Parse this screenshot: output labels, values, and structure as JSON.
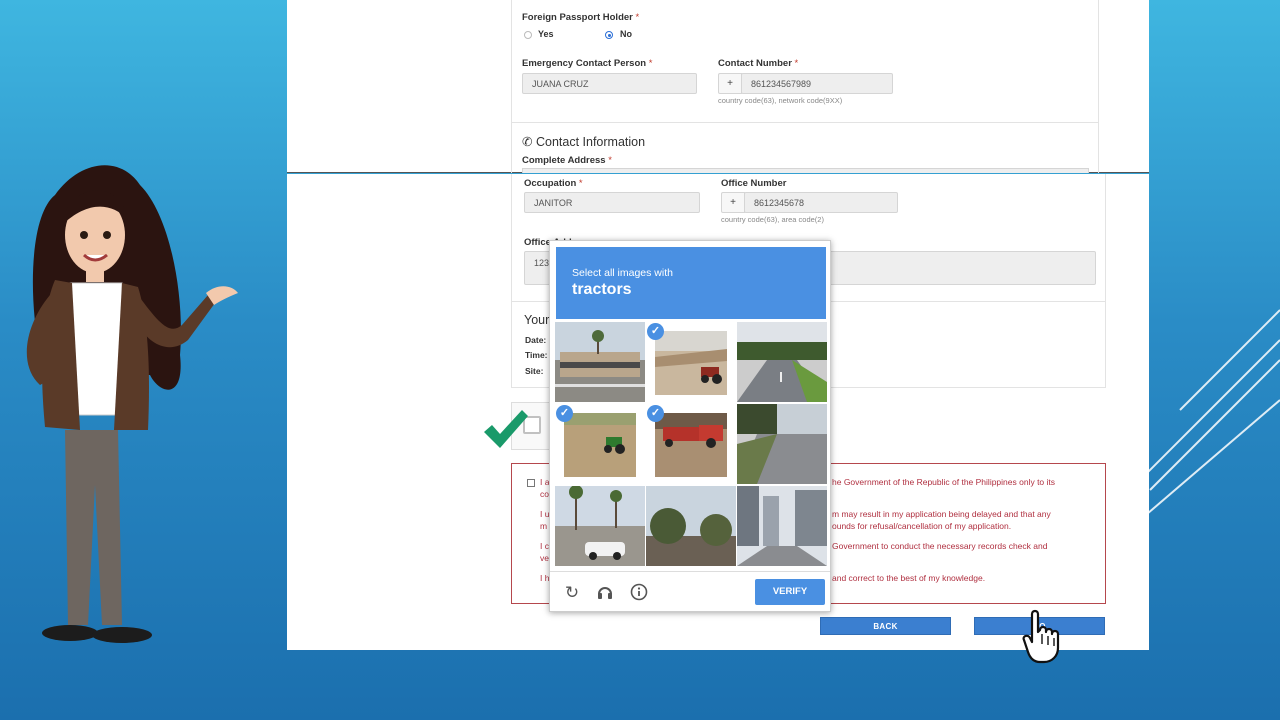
{
  "form_top": {
    "foreign_passport_label": "Foreign Passport Holder",
    "required_mark": "*",
    "yes_label": "Yes",
    "no_label": "No",
    "selected": "No",
    "emergency_contact_label": "Emergency Contact Person",
    "emergency_contact_value": "JUANA CRUZ",
    "contact_number_label": "Contact Number",
    "contact_prefix": "+",
    "contact_number_value": "861234567989",
    "contact_hint": "country code(63), network code(9XX)",
    "contact_info_heading": "Contact Information",
    "complete_address_label": "Complete Address"
  },
  "form_bottom": {
    "occupation_label": "Occupation",
    "occupation_value": "JANITOR",
    "office_number_label": "Office Number",
    "office_prefix": "+",
    "office_number_value": "8612345678",
    "office_hint": "country code(63), area code(2)",
    "office_address_label": "Office Address",
    "office_address_value": "123",
    "your_heading": "Your",
    "date_label": "Date:",
    "time_label": "Time:",
    "site_label": "Site:"
  },
  "consent": {
    "line1_start": "I a",
    "line1_end": "he Government of the Republic of the Philippines only to its",
    "line1b": "co",
    "line2_start": "I u",
    "line2_end": "m may result in my application being delayed and that any",
    "line2b_start": "m",
    "line2b_end": "ounds for refusal/cancellation of my application.",
    "line3_start": "I c",
    "line3_end": "Government to conduct the necessary records check and",
    "line3b": "ve",
    "line4_start": "I h",
    "line4_end": "and correct to the best of my knowledge."
  },
  "buttons": {
    "back": "BACK",
    "continue": "CO"
  },
  "captcha": {
    "instruction": "Select all images with",
    "target": "tractors",
    "verify": "VERIFY",
    "reload_icon": "reload-icon",
    "audio_icon": "headphones-icon",
    "info_icon": "info-icon",
    "tiles": [
      {
        "selected": false,
        "scene": "building-with-palm"
      },
      {
        "selected": true,
        "scene": "tractor-on-dirt"
      },
      {
        "selected": false,
        "scene": "highway-curve"
      },
      {
        "selected": true,
        "scene": "green-tractor-field"
      },
      {
        "selected": true,
        "scene": "red-machinery"
      },
      {
        "selected": false,
        "scene": "road-with-trees"
      },
      {
        "selected": false,
        "scene": "palm-street-car"
      },
      {
        "selected": false,
        "scene": "trees-and-sky"
      },
      {
        "selected": false,
        "scene": "city-skyscrapers"
      }
    ]
  },
  "colors": {
    "captcha_blue": "#4a90e2",
    "button_blue": "#3b7fd0",
    "consent_red": "#b5474d",
    "check_green": "#1a9a6a"
  }
}
